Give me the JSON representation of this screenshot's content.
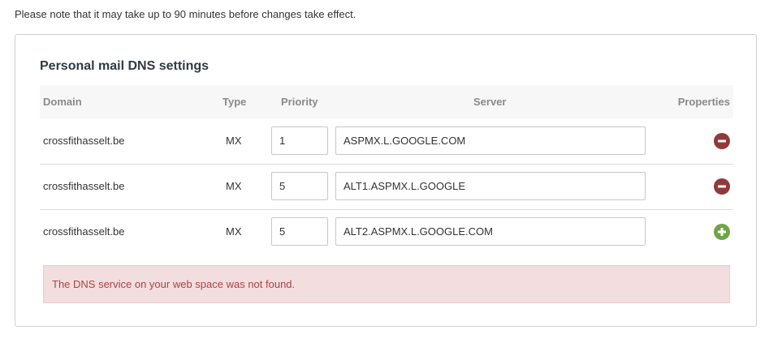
{
  "notice": "Please note that it may take up to 90 minutes before changes take effect.",
  "panel": {
    "title": "Personal mail DNS settings",
    "columns": {
      "domain": "Domain",
      "type": "Type",
      "priority": "Priority",
      "server": "Server",
      "properties": "Properties"
    },
    "records": [
      {
        "domain": "crossfithasselt.be",
        "type": "MX",
        "priority": "1",
        "server": "ASPMX.L.GOOGLE.COM",
        "action": "remove-icon"
      },
      {
        "domain": "crossfithasselt.be",
        "type": "MX",
        "priority": "5",
        "server": "ALT1.ASPMX.L.GOOGLE",
        "action": "remove-icon"
      },
      {
        "domain": "crossfithasselt.be",
        "type": "MX",
        "priority": "5",
        "server": "ALT2.ASPMX.L.GOOGLE.COM",
        "action": "add-icon"
      }
    ],
    "alert": "The DNS service on your web space was not found."
  },
  "colors": {
    "remove": "#913a3a",
    "add": "#6fa546",
    "alert_bg": "#f2dede",
    "alert_text": "#a94442"
  }
}
